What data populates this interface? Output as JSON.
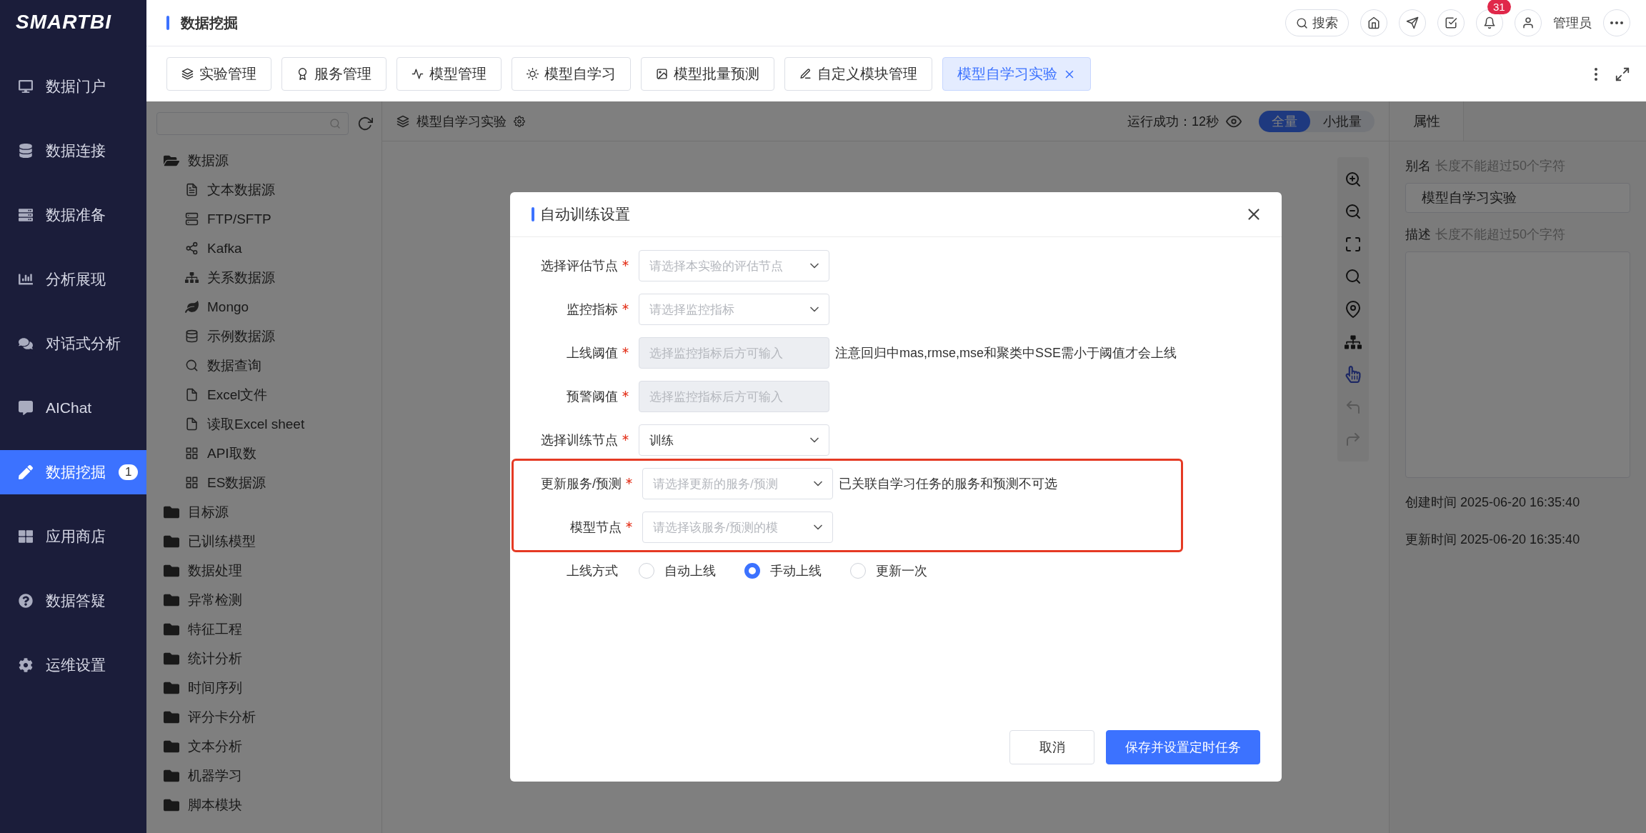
{
  "app": {
    "logo": "SMARTBI"
  },
  "sidebar": {
    "items": [
      {
        "label": "数据门户",
        "selected": false
      },
      {
        "label": "数据连接",
        "selected": false
      },
      {
        "label": "数据准备",
        "selected": false
      },
      {
        "label": "分析展现",
        "selected": false
      },
      {
        "label": "对话式分析",
        "selected": false
      },
      {
        "label": "AIChat",
        "selected": false
      },
      {
        "label": "数据挖掘",
        "selected": true,
        "badge": "1"
      },
      {
        "label": "应用商店",
        "selected": false
      },
      {
        "label": "数据答疑",
        "selected": false
      },
      {
        "label": "运维设置",
        "selected": false
      }
    ]
  },
  "header": {
    "title": "数据挖掘",
    "search": "搜索",
    "notifications": "31",
    "user": "管理员"
  },
  "tabs": [
    {
      "label": "实验管理",
      "selected": false,
      "closable": false
    },
    {
      "label": "服务管理",
      "selected": false,
      "closable": false
    },
    {
      "label": "模型管理",
      "selected": false,
      "closable": false
    },
    {
      "label": "模型自学习",
      "selected": false,
      "closable": false
    },
    {
      "label": "模型批量预测",
      "selected": false,
      "closable": false
    },
    {
      "label": "自定义模块管理",
      "selected": false,
      "closable": false
    },
    {
      "label": "模型自学习实验",
      "selected": true,
      "closable": true
    }
  ],
  "tree": {
    "items": [
      {
        "label": "数据源",
        "expanded": true,
        "children": [
          {
            "label": "文本数据源"
          },
          {
            "label": "FTP/SFTP"
          },
          {
            "label": "Kafka"
          },
          {
            "label": "关系数据源"
          },
          {
            "label": "Mongo"
          },
          {
            "label": "示例数据源"
          },
          {
            "label": "数据查询"
          },
          {
            "label": "Excel文件"
          },
          {
            "label": "读取Excel sheet"
          },
          {
            "label": "API取数"
          },
          {
            "label": "ES数据源"
          }
        ]
      },
      {
        "label": "目标源",
        "expanded": false
      },
      {
        "label": "已训练模型",
        "expanded": false
      },
      {
        "label": "数据处理",
        "expanded": false
      },
      {
        "label": "异常检测",
        "expanded": false
      },
      {
        "label": "特征工程",
        "expanded": false
      },
      {
        "label": "统计分析",
        "expanded": false
      },
      {
        "label": "时间序列",
        "expanded": false
      },
      {
        "label": "评分卡分析",
        "expanded": false
      },
      {
        "label": "文本分析",
        "expanded": false
      },
      {
        "label": "机器学习",
        "expanded": false
      },
      {
        "label": "脚本模块",
        "expanded": false
      }
    ]
  },
  "canvas": {
    "title": "模型自学习实验",
    "status": "运行成功：12秒",
    "modes": [
      {
        "label": "全量",
        "selected": true
      },
      {
        "label": "小批量",
        "selected": false
      }
    ],
    "tools": [
      {
        "selected": false,
        "disabled": false
      },
      {
        "selected": false,
        "disabled": false
      },
      {
        "selected": false,
        "disabled": false
      },
      {
        "selected": false,
        "disabled": false
      },
      {
        "selected": false,
        "disabled": false
      },
      {
        "selected": false,
        "disabled": false
      },
      {
        "selected": true,
        "disabled": false
      },
      {
        "selected": false,
        "disabled": true
      },
      {
        "selected": false,
        "disabled": true
      }
    ]
  },
  "properties": {
    "tab": "属性",
    "alias_label": "别名",
    "alias_hint": "长度不能超过50个字符",
    "alias_value": "模型自学习实验",
    "desc_label": "描述",
    "desc_hint": "长度不能超过50个字符",
    "created": "创建时间 2025-06-20 16:35:40",
    "updated": "更新时间 2025-06-20 16:35:40"
  },
  "dialog": {
    "title": "自动训练设置",
    "rows": [
      {
        "kind": "select",
        "label": "选择评估节点",
        "required": true,
        "placeholder": "请选择本实验的评估节点",
        "highlighted": false
      },
      {
        "kind": "select",
        "label": "监控指标",
        "required": true,
        "placeholder": "请选择监控指标",
        "highlighted": false
      },
      {
        "kind": "input",
        "label": "上线阈值",
        "required": true,
        "placeholder": "选择监控指标后方可输入",
        "disabled": true,
        "note": "注意回归中mas,rmse,mse和聚类中SSE需小于阈值才会上线",
        "highlighted": false
      },
      {
        "kind": "input",
        "label": "预警阈值",
        "required": true,
        "placeholder": "选择监控指标后方可输入",
        "disabled": true,
        "highlighted": false
      },
      {
        "kind": "select",
        "label": "选择训练节点",
        "required": true,
        "value": "训练",
        "highlighted": false
      },
      {
        "kind": "select",
        "label": "更新服务/预测",
        "required": true,
        "placeholder": "请选择更新的服务/预测",
        "note": "已关联自学习任务的服务和预测不可选",
        "highlighted": true
      },
      {
        "kind": "select",
        "label": "模型节点",
        "required": true,
        "placeholder": "请选择该服务/预测的模",
        "highlighted": true
      },
      {
        "kind": "radio",
        "label": "上线方式",
        "required": false,
        "highlighted": false,
        "options": [
          {
            "label": "自动上线",
            "selected": false
          },
          {
            "label": "手动上线",
            "selected": true
          },
          {
            "label": "更新一次",
            "selected": false
          }
        ]
      }
    ],
    "buttons": [
      {
        "label": "取消",
        "primary": false
      },
      {
        "label": "保存并设置定时任务",
        "primary": true
      }
    ]
  }
}
